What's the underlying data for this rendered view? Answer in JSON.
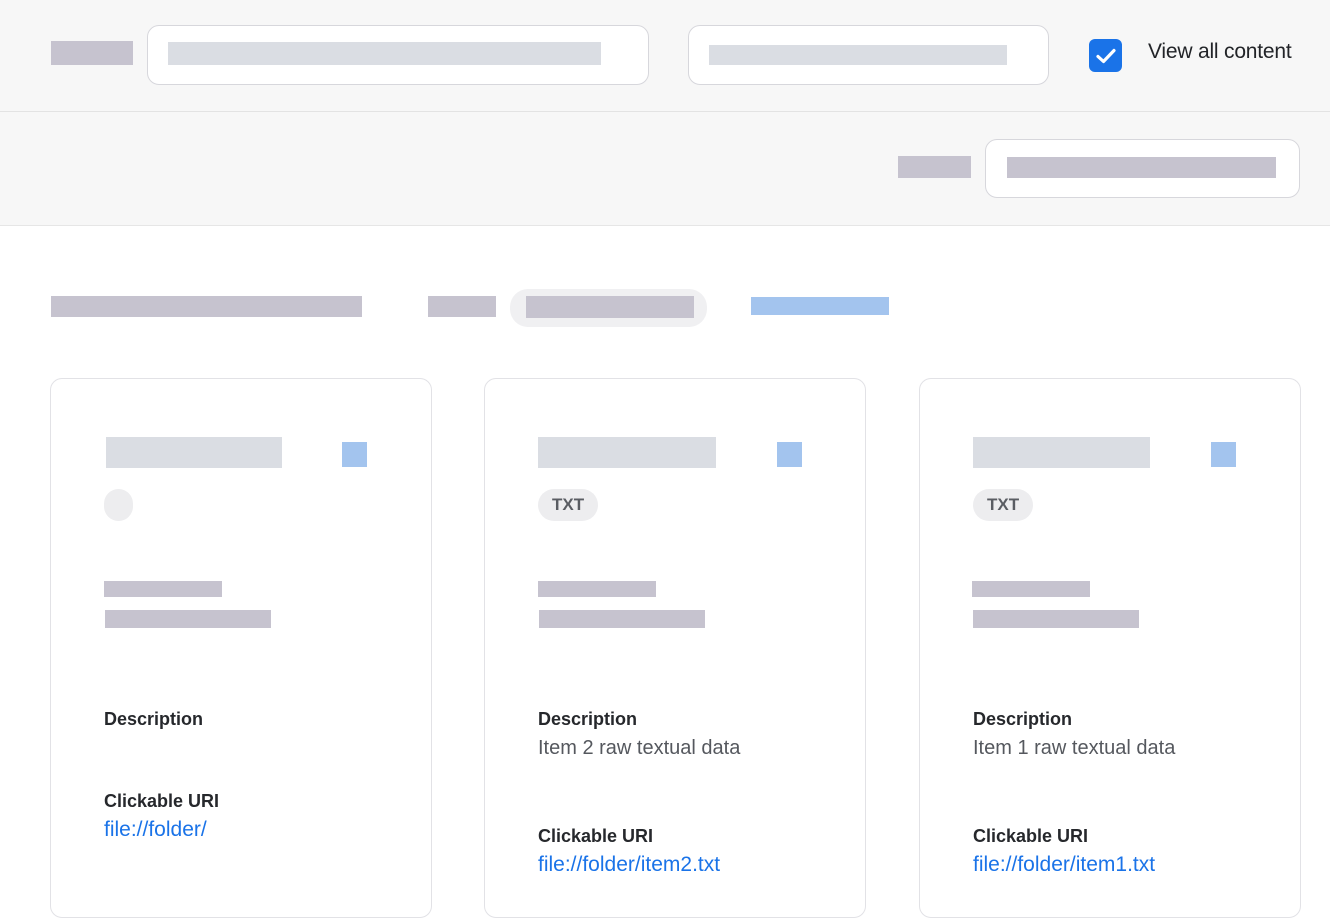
{
  "header": {
    "view_all": {
      "label": "View all content",
      "checked": true
    }
  },
  "cards": [
    {
      "badge": "",
      "description_label": "Description",
      "description": "",
      "uri_label": "Clickable URI",
      "uri": "file://folder/"
    },
    {
      "badge": "TXT",
      "description_label": "Description",
      "description": "Item 2 raw textual data",
      "uri_label": "Clickable URI",
      "uri": "file://folder/item2.txt"
    },
    {
      "badge": "TXT",
      "description_label": "Description",
      "description": "Item 1 raw textual data",
      "uri_label": "Clickable URI",
      "uri": "file://folder/item1.txt"
    }
  ],
  "colors": {
    "accent": "#1a73e8",
    "placeholder": "#c6c3cf",
    "placeholder_light": "#dadde3",
    "placeholder_blue": "#a3c4ee"
  }
}
